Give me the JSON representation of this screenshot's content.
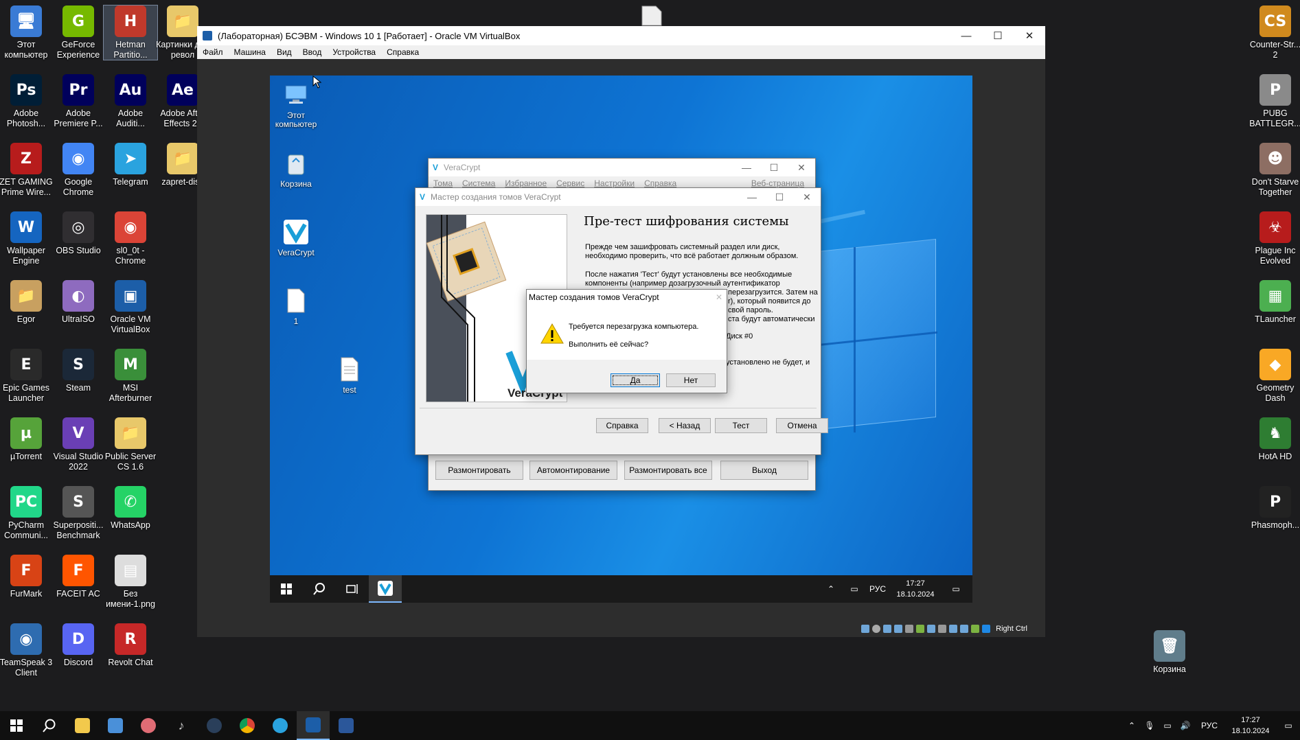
{
  "desktop": {
    "icons": [
      {
        "label": "Этот компьютер",
        "glyph": "🖥",
        "color": "#3a7bd5"
      },
      {
        "label": "GeForce Experience",
        "glyph": "G",
        "color": "#76b900"
      },
      {
        "label": "Hetman Partitio...",
        "glyph": "H",
        "color": "#c0392b"
      },
      {
        "label": "Картинки для револ",
        "glyph": "📁",
        "color": "#e8c86a"
      },
      {
        "label": "Adobe Photosh...",
        "glyph": "Ps",
        "color": "#001e36"
      },
      {
        "label": "Adobe Premiere P...",
        "glyph": "Pr",
        "color": "#00005b"
      },
      {
        "label": "Adobe Auditi...",
        "glyph": "Au",
        "color": "#00005b"
      },
      {
        "label": "Adobe After Effects 20",
        "glyph": "Ae",
        "color": "#00005b"
      },
      {
        "label": "ZET GAMING Prime Wire...",
        "glyph": "Z",
        "color": "#b71c1c"
      },
      {
        "label": "Google Chrome",
        "glyph": "◉",
        "color": "#4285f4"
      },
      {
        "label": "Telegram",
        "glyph": "➤",
        "color": "#2aa3df"
      },
      {
        "label": "zapret-disc",
        "glyph": "📁",
        "color": "#e8c86a"
      },
      {
        "label": "Wallpaper Engine",
        "glyph": "W",
        "color": "#1565c0"
      },
      {
        "label": "OBS Studio",
        "glyph": "◎",
        "color": "#302e31"
      },
      {
        "label": "sl0_0t - Chrome",
        "glyph": "◉",
        "color": "#db4437"
      },
      {
        "label": "Egor",
        "glyph": "📁",
        "color": "#c8a060"
      },
      {
        "label": "UltraISO",
        "glyph": "◐",
        "color": "#8e6bbf"
      },
      {
        "label": "Oracle VM VirtualBox",
        "glyph": "▣",
        "color": "#1c5ea8"
      },
      {
        "label": "Epic Games Launcher",
        "glyph": "E",
        "color": "#2a2a2a"
      },
      {
        "label": "Steam",
        "glyph": "S",
        "color": "#1b2838"
      },
      {
        "label": "MSI Afterburner",
        "glyph": "M",
        "color": "#3a8f3a"
      },
      {
        "label": "µTorrent",
        "glyph": "µ",
        "color": "#56a33a"
      },
      {
        "label": "Visual Studio 2022",
        "glyph": "V",
        "color": "#6a3fb5"
      },
      {
        "label": "Public Server CS 1.6",
        "glyph": "📁",
        "color": "#e8c86a"
      },
      {
        "label": "PyCharm Communi...",
        "glyph": "PC",
        "color": "#21d789"
      },
      {
        "label": "Superpositi... Benchmark",
        "glyph": "S",
        "color": "#555"
      },
      {
        "label": "WhatsApp",
        "glyph": "✆",
        "color": "#25d366"
      },
      {
        "label": "FurMark",
        "glyph": "F",
        "color": "#d84315"
      },
      {
        "label": "FACEIT AC",
        "glyph": "F",
        "color": "#ff5500"
      },
      {
        "label": "Без имени-1.png",
        "glyph": "▤",
        "color": "#ddd"
      },
      {
        "label": "TeamSpeak 3 Client",
        "glyph": "◉",
        "color": "#2e6cb0"
      },
      {
        "label": "Discord",
        "glyph": "D",
        "color": "#5865f2"
      },
      {
        "label": "Revolt Chat",
        "glyph": "R",
        "color": "#c62828"
      },
      {
        "label": "Counter-Str... 2",
        "glyph": "CS",
        "color": "#d08a1e"
      },
      {
        "label": "PUBG BATTLEGR...",
        "glyph": "P",
        "color": "#8a8a8a"
      },
      {
        "label": "Don't Starve Together",
        "glyph": "☻",
        "color": "#8d6e63"
      },
      {
        "label": "Plague Inc Evolved",
        "glyph": "☣",
        "color": "#b71c1c"
      },
      {
        "label": "TLauncher",
        "glyph": "▦",
        "color": "#4caf50"
      },
      {
        "label": "Geometry Dash",
        "glyph": "◆",
        "color": "#f9a825"
      },
      {
        "label": "HotA HD",
        "glyph": "♞",
        "color": "#2e7d32"
      },
      {
        "label": "Phasmoph...",
        "glyph": "P",
        "color": "#222"
      },
      {
        "label": "Корзина",
        "glyph": "🗑",
        "color": "#607d8b"
      }
    ]
  },
  "vbox": {
    "title": "(Лабораторная) БСЭВМ - Windows 10 1 [Работает] - Oracle VM VirtualBox",
    "menu": [
      "Файл",
      "Машина",
      "Вид",
      "Ввод",
      "Устройства",
      "Справка"
    ],
    "host_key": "Right Ctrl"
  },
  "guest": {
    "icons": [
      {
        "label": "Этот компьютер"
      },
      {
        "label": "Корзина"
      },
      {
        "label": "VeraCrypt"
      },
      {
        "label": "1"
      },
      {
        "label": "test"
      }
    ],
    "taskbar": {
      "lang": "РУС",
      "time": "17:27",
      "date": "18.10.2024"
    }
  },
  "veracrypt_main": {
    "title": "VeraCrypt",
    "menu": [
      "Тома",
      "Система",
      "Избранное",
      "Сервис",
      "Настройки",
      "Справка"
    ],
    "homepage": "Веб-страница",
    "buttons": [
      "Размонтировать",
      "Автомонтирование",
      "Размонтировать все",
      "Выход"
    ]
  },
  "wizard": {
    "title": "Мастер создания томов VeraCrypt",
    "heading": "Пре-тест шифрования системы",
    "p1": "Прежде чем зашифровать системный раздел или диск, необходимо проверить, что всё работает должным образом.",
    "p2a": "После нажатия 'Тест' будут установлены все необходимые",
    "p2b": "компоненты (например дозагрузочный аутентификатор",
    "p2c": "перезагрузится. Затем на",
    "p2d": "r), который появится до",
    "p2e": "свой пароль.",
    "p2f": "ста будут автоматически",
    "p3": "Диск #0",
    "p4": "установлено не будет, и",
    "brand": "VeraCrypt",
    "buttons": {
      "help": "Справка",
      "back": "< Назад",
      "test": "Тест",
      "cancel": "Отмена"
    }
  },
  "dialog": {
    "title": "Мастер создания томов VeraCrypt",
    "line1": "Требуется перезагрузка компьютера.",
    "line2": "Выполнить её сейчас?",
    "yes": "Да",
    "no": "Нет"
  },
  "host_taskbar": {
    "lang": "РУС",
    "time": "17:27",
    "date": "18.10.2024"
  },
  "colors": {
    "accent": "#0078d7",
    "guest_bg": "#0e74d4"
  }
}
